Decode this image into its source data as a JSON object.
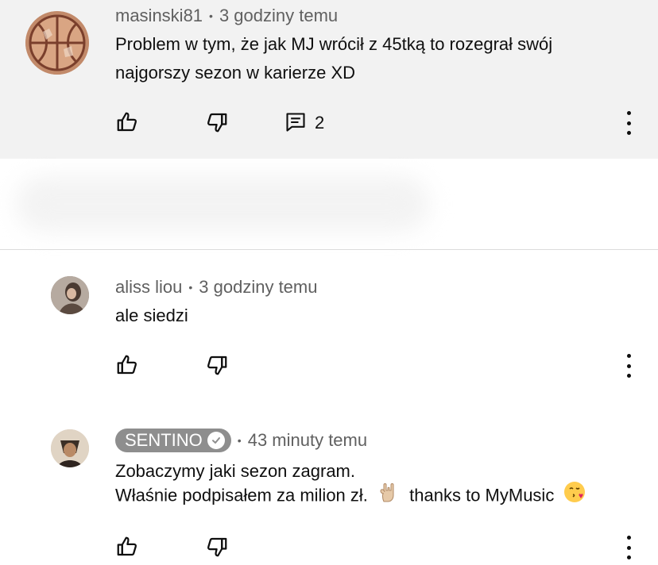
{
  "comments": [
    {
      "author": "masinski81",
      "time": "3 godziny temu",
      "lines": [
        "Problem w tym, że jak MJ wrócił z 45tką to rozegrał swój",
        "najgorszy sezon w karierze XD"
      ],
      "reply_count": "2",
      "avatar_icon": "basketball-icon"
    },
    {
      "author": "aliss liou",
      "time": "3 godziny temu",
      "lines": [
        "ale siedzi"
      ],
      "avatar_icon": "profile-photo"
    },
    {
      "author": "SENTINO",
      "verified": true,
      "time": "43 minuty temu",
      "line1": "Zobaczymy jaki sezon zagram.",
      "line2_a": "Właśnie podpisałem za milion zł.",
      "line2_b": "thanks to MyMusic",
      "emojis": [
        "rock-on-hand-emoji",
        "face-blowing-kiss-emoji"
      ],
      "avatar_icon": "profile-photo"
    }
  ],
  "icons": {
    "like": "thumbs-up-icon",
    "dislike": "thumbs-down-icon",
    "reply": "comment-icon",
    "more": "more-vert-icon"
  },
  "colors": {
    "highlight_bg": "#f2f2f2",
    "meta_text": "#606060",
    "badge_bg": "#8e8e8e"
  }
}
